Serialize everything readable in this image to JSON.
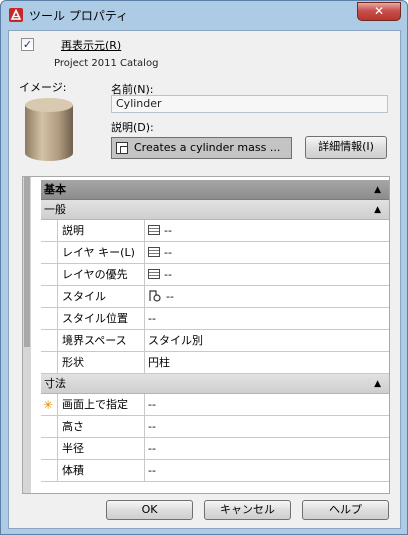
{
  "window": {
    "title": "ツール プロパティ",
    "close_glyph": "✕"
  },
  "checkbox": {
    "checked_glyph": "✓",
    "label": "再表示元(R)"
  },
  "catalog_name": "Project 2011 Catalog",
  "image": {
    "label": "イメージ:"
  },
  "name": {
    "label": "名前(N):",
    "value": "Cylinder"
  },
  "description": {
    "label": "説明(D):",
    "value": "Creates a cylinder mass ...",
    "details_button": "詳細情報(I)"
  },
  "properties": {
    "category_main": {
      "label": "基本",
      "collapse_glyph": "▲"
    },
    "general": {
      "label": "一般",
      "collapse_glyph": "▲",
      "rows": [
        {
          "name": "説明",
          "value": "--",
          "icon": "list-icon"
        },
        {
          "name": "レイヤ キー(L)",
          "value": "--",
          "icon": "list-icon"
        },
        {
          "name": "レイヤの優先",
          "value": "--",
          "icon": "list-icon"
        },
        {
          "name": "スタイル",
          "value": "--",
          "icon": "style-icon"
        },
        {
          "name": "スタイル位置",
          "value": "--"
        },
        {
          "name": "境界スペース",
          "value": "スタイル別"
        },
        {
          "name": "形状",
          "value": "円柱"
        }
      ]
    },
    "dimensions": {
      "label": "寸法",
      "collapse_glyph": "▲",
      "required_glyph": "✳",
      "rows": [
        {
          "name": "画面上で指定",
          "value": "--",
          "required": true
        },
        {
          "name": "高さ",
          "value": "--"
        },
        {
          "name": "半径",
          "value": "--"
        },
        {
          "name": "体積",
          "value": "--"
        }
      ]
    }
  },
  "buttons": {
    "ok": "OK",
    "cancel": "キャンセル",
    "help": "ヘルプ"
  },
  "colors": {
    "close_button": "#c75050",
    "category_header": "#999999",
    "required_marker": "#e08a00"
  }
}
